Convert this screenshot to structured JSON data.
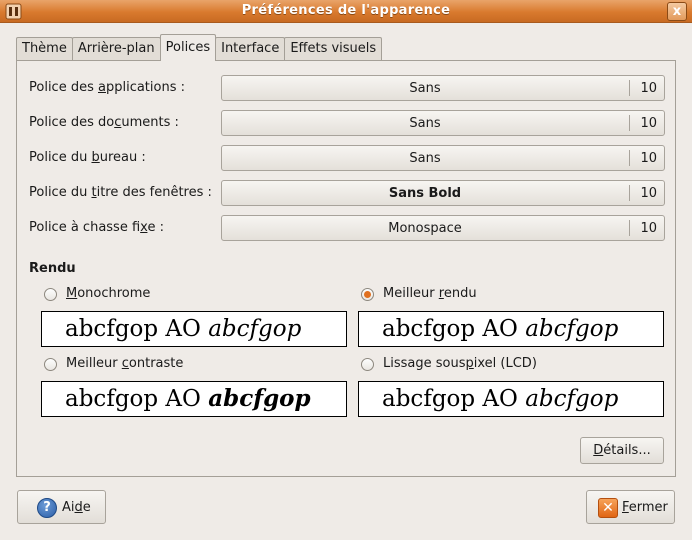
{
  "window": {
    "title": "Préférences de l'apparence",
    "close_glyph": "x"
  },
  "tabs": [
    {
      "label": "Thème"
    },
    {
      "label": "Arrière-plan"
    },
    {
      "label": "Polices",
      "active": true
    },
    {
      "label": "Interface"
    },
    {
      "label": "Effets visuels"
    }
  ],
  "fonts": [
    {
      "label_pre": "Police des ",
      "label_key": "a",
      "label_post": "pplications :",
      "font": "Sans",
      "size": "10"
    },
    {
      "label_pre": "Police des do",
      "label_key": "c",
      "label_post": "uments :",
      "font": "Sans",
      "size": "10"
    },
    {
      "label_pre": "Police du ",
      "label_key": "b",
      "label_post": "ureau :",
      "font": "Sans",
      "size": "10"
    },
    {
      "label_pre": "Police du ",
      "label_key": "t",
      "label_post": "itre des fenêtres :",
      "font": "Sans Bold",
      "size": "10"
    },
    {
      "label_pre": "Police à chasse fi",
      "label_key": "x",
      "label_post": "e :",
      "font": "Monospace",
      "size": "10"
    }
  ],
  "rendering": {
    "title": "Rendu",
    "options": [
      {
        "label_pre": "",
        "label_key": "M",
        "label_post": "onochrome",
        "checked": false
      },
      {
        "label_pre": "Meilleur ",
        "label_key": "r",
        "label_post": "endu",
        "checked": true
      },
      {
        "label_pre": "Meilleur ",
        "label_key": "c",
        "label_post": "ontraste",
        "checked": false
      },
      {
        "label_pre": "Lissage sous",
        "label_key": "p",
        "label_post": "ixel (LCD)",
        "checked": false
      }
    ],
    "sample_regular": "abcfgop AO ",
    "sample_italic": "abcfgop"
  },
  "buttons": {
    "details": {
      "pre": "",
      "key": "D",
      "post": "étails..."
    },
    "help": {
      "pre": "Ai",
      "key": "d",
      "post": "e",
      "icon": "help-icon",
      "glyph": "?"
    },
    "close": {
      "pre": "",
      "key": "F",
      "post": "ermer",
      "icon": "close-icon",
      "glyph": "✕"
    }
  },
  "colors": {
    "titlebar": "#d97a2e",
    "radio_checked": "#e07020"
  }
}
